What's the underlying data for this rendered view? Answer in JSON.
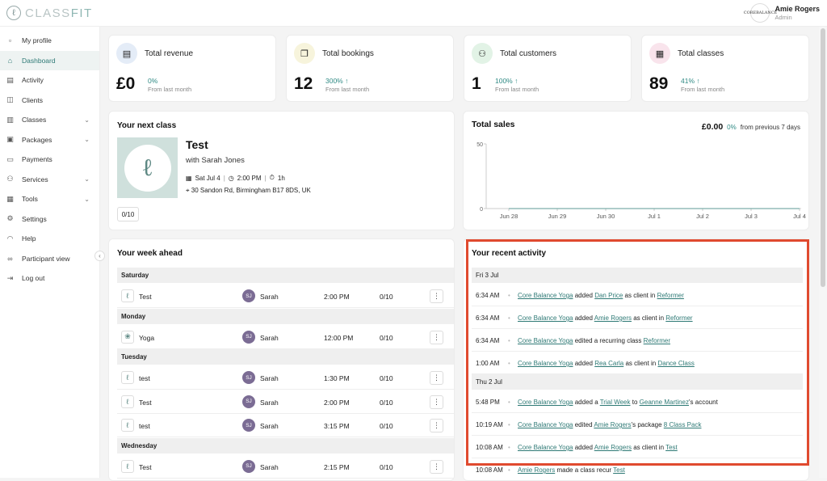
{
  "app": {
    "logo_text_a": "CLASS",
    "logo_text_b": "FIT"
  },
  "user": {
    "name": "Amie Rogers",
    "role": "Admin",
    "avatar_text": "CORE\nBALANCE"
  },
  "sidebar": {
    "items": [
      {
        "label": "My profile",
        "icon": "core-logo-icon",
        "glyph": "▫"
      },
      {
        "label": "Dashboard",
        "icon": "home-icon",
        "glyph": "⌂",
        "active": true
      },
      {
        "label": "Activity",
        "icon": "clipboard-icon",
        "glyph": "▤"
      },
      {
        "label": "Clients",
        "icon": "clients-icon",
        "glyph": "◫"
      },
      {
        "label": "Classes",
        "icon": "book-icon",
        "glyph": "▥",
        "chevron": true
      },
      {
        "label": "Packages",
        "icon": "package-icon",
        "glyph": "▣",
        "chevron": true
      },
      {
        "label": "Payments",
        "icon": "card-icon",
        "glyph": "▭"
      },
      {
        "label": "Services",
        "icon": "users-icon",
        "glyph": "⚇",
        "chevron": true
      },
      {
        "label": "Tools",
        "icon": "briefcase-icon",
        "glyph": "▦",
        "chevron": true
      },
      {
        "label": "Settings",
        "icon": "gear-icon",
        "glyph": "⚙"
      },
      {
        "label": "Help",
        "icon": "headset-icon",
        "glyph": "◠"
      },
      {
        "label": "Participant view",
        "icon": "glasses-icon",
        "glyph": "∞"
      },
      {
        "label": "Log out",
        "icon": "logout-icon",
        "glyph": "⇥"
      }
    ]
  },
  "stats": [
    {
      "label": "Total revenue",
      "value": "£0",
      "pct": "0%",
      "arrow": "",
      "sub": "From last month",
      "icon": "revenue-icon",
      "glyph": "▤",
      "bg": "#e4ecf7"
    },
    {
      "label": "Total bookings",
      "value": "12",
      "pct": "300% ↑",
      "arrow": "",
      "sub": "From last month",
      "icon": "bookings-icon",
      "glyph": "❐",
      "bg": "#f7f4dc"
    },
    {
      "label": "Total customers",
      "value": "1",
      "pct": "100% ↑",
      "arrow": "",
      "sub": "From last month",
      "icon": "customers-icon",
      "glyph": "⚇",
      "bg": "#e2f3e6"
    },
    {
      "label": "Total classes",
      "value": "89",
      "pct": "41% ↑",
      "arrow": "",
      "sub": "From last month",
      "icon": "calendar-icon",
      "glyph": "▦",
      "bg": "#f9e4ec"
    }
  ],
  "next_class": {
    "heading": "Your next class",
    "name": "Test",
    "with": "with Sarah Jones",
    "date": "Sat Jul 4",
    "time": "2:00 PM",
    "duration": "1h",
    "address": "30 Sandon Rd, Birmingham B17 8DS, UK",
    "capacity": "0/10"
  },
  "sales": {
    "heading": "Total sales",
    "total": "£0.00",
    "pct": "0%",
    "period": "from previous 7 days"
  },
  "chart_data": {
    "type": "line",
    "title": "Total sales",
    "categories": [
      "Jun 28",
      "Jun 29",
      "Jun 30",
      "Jul 1",
      "Jul 2",
      "Jul 3",
      "Jul 4"
    ],
    "values": [
      0,
      0,
      0,
      0,
      0,
      0,
      0
    ],
    "yticks": [
      "0",
      "50"
    ],
    "ylim": [
      0,
      50
    ],
    "grid": false
  },
  "week": {
    "heading": "Your week ahead",
    "groups": [
      {
        "day": "Saturday",
        "rows": [
          {
            "name": "Test",
            "trainer": "Sarah",
            "time": "2:00 PM",
            "cap": "0/10",
            "initials": "SJ"
          }
        ]
      },
      {
        "day": "Monday",
        "rows": [
          {
            "name": "Yoga",
            "trainer": "Sarah",
            "time": "12:00 PM",
            "cap": "0/10",
            "initials": "SJ"
          }
        ]
      },
      {
        "day": "Tuesday",
        "rows": [
          {
            "name": "test",
            "trainer": "Sarah",
            "time": "1:30 PM",
            "cap": "0/10",
            "initials": "SJ"
          },
          {
            "name": "Test",
            "trainer": "Sarah",
            "time": "2:00 PM",
            "cap": "0/10",
            "initials": "SJ"
          },
          {
            "name": "test",
            "trainer": "Sarah",
            "time": "3:15 PM",
            "cap": "0/10",
            "initials": "SJ"
          }
        ]
      },
      {
        "day": "Wednesday",
        "rows": [
          {
            "name": "Test",
            "trainer": "Sarah",
            "time": "2:15 PM",
            "cap": "0/10",
            "initials": "SJ"
          }
        ]
      }
    ]
  },
  "activity": {
    "heading": "Your recent activity",
    "groups": [
      {
        "date": "Fri 3 Jul",
        "rows": [
          {
            "time": "6:34 AM",
            "parts": [
              {
                "t": "Core Balance Yoga",
                "link": true
              },
              {
                "t": " added "
              },
              {
                "t": "Dan Price",
                "link": true
              },
              {
                "t": " as client in "
              },
              {
                "t": "Reformer",
                "link": true
              }
            ]
          },
          {
            "time": "6:34 AM",
            "parts": [
              {
                "t": "Core Balance Yoga",
                "link": true
              },
              {
                "t": " added "
              },
              {
                "t": "Amie Rogers",
                "link": true
              },
              {
                "t": " as client in "
              },
              {
                "t": "Reformer",
                "link": true
              }
            ]
          },
          {
            "time": "6:34 AM",
            "parts": [
              {
                "t": "Core Balance Yoga",
                "link": true
              },
              {
                "t": " edited a recurring class "
              },
              {
                "t": "Reformer",
                "link": true
              }
            ]
          },
          {
            "time": "1:00 AM",
            "parts": [
              {
                "t": "Core Balance Yoga",
                "link": true
              },
              {
                "t": " added "
              },
              {
                "t": "Rea Carla",
                "link": true
              },
              {
                "t": " as client in "
              },
              {
                "t": "Dance Class",
                "link": true
              }
            ]
          }
        ]
      },
      {
        "date": "Thu 2 Jul",
        "rows": [
          {
            "time": "5:48 PM",
            "parts": [
              {
                "t": "Core Balance Yoga",
                "link": true
              },
              {
                "t": " added a "
              },
              {
                "t": "Trial Week",
                "link": true
              },
              {
                "t": " to "
              },
              {
                "t": "Geanne Martinez",
                "link": true
              },
              {
                "t": "'s account"
              }
            ]
          },
          {
            "time": "10:19 AM",
            "parts": [
              {
                "t": "Core Balance Yoga",
                "link": true
              },
              {
                "t": " edited "
              },
              {
                "t": "Amie Rogers",
                "link": true
              },
              {
                "t": "'s package "
              },
              {
                "t": "8 Class Pack",
                "link": true
              }
            ]
          },
          {
            "time": "10:08 AM",
            "parts": [
              {
                "t": "Core Balance Yoga",
                "link": true
              },
              {
                "t": " added "
              },
              {
                "t": "Amie Rogers",
                "link": true
              },
              {
                "t": " as client in "
              },
              {
                "t": "Test",
                "link": true
              }
            ]
          },
          {
            "time": "10:08 AM",
            "parts": [
              {
                "t": "Amie Rogers",
                "link": true
              },
              {
                "t": " made a class recur "
              },
              {
                "t": "Test",
                "link": true
              }
            ]
          }
        ]
      }
    ]
  }
}
